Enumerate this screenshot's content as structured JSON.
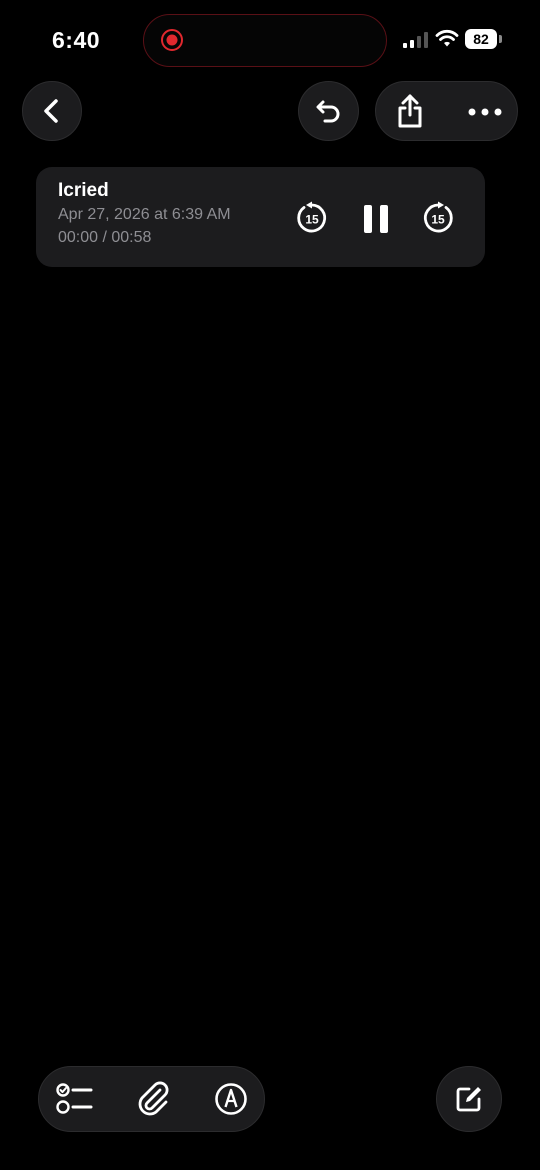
{
  "status_bar": {
    "time": "6:40",
    "battery": "82",
    "recording_indicator_color": "#e0282e"
  },
  "nav": {
    "back_icon": "chevron-left-icon",
    "undo_icon": "undo-icon",
    "share_icon": "share-icon",
    "more_icon": "ellipsis-icon"
  },
  "audio": {
    "title": "Icried",
    "date": "Apr 27, 2026 at 6:39 AM",
    "time": "00:00 / 00:58",
    "skip_back_label": "15",
    "skip_forward_label": "15"
  },
  "toolbar": {
    "checklist_icon": "checklist-icon",
    "attach_icon": "paperclip-icon",
    "markup_icon": "markup-pen-icon",
    "compose_icon": "compose-icon"
  },
  "colors": {
    "background": "#000000",
    "surface": "#1c1c1e",
    "secondary_text": "#8e8e93"
  }
}
